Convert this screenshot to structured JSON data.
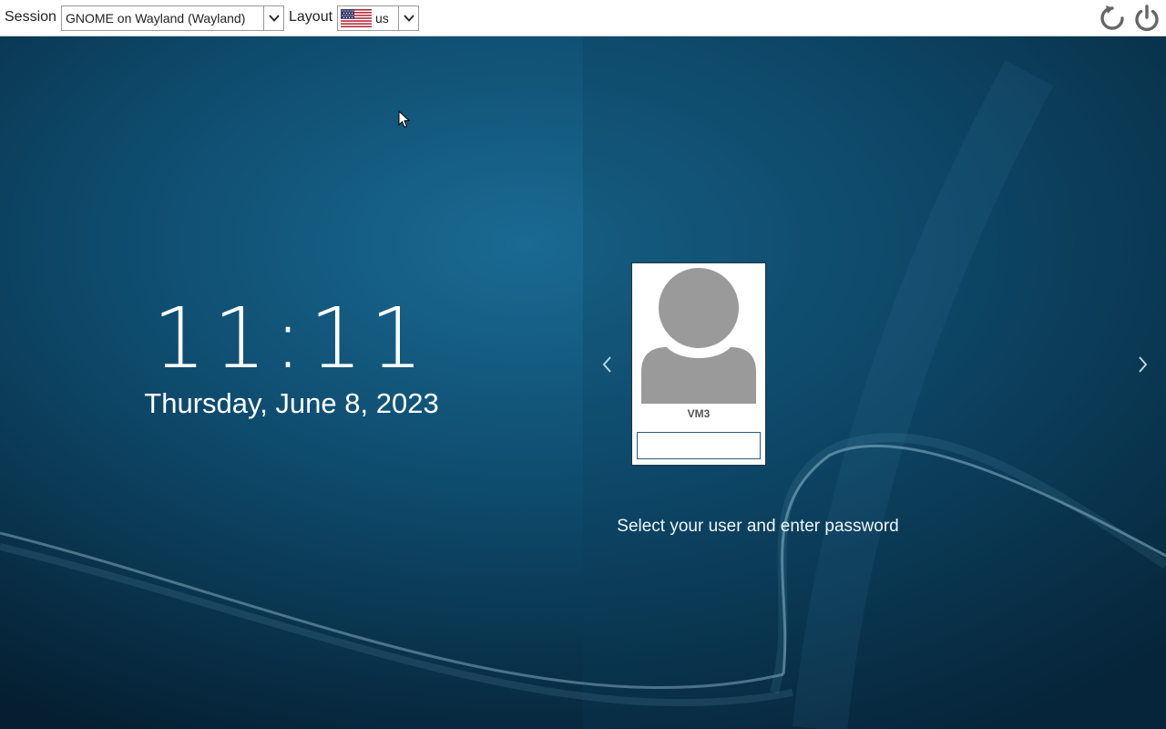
{
  "topbar": {
    "session_label": "Session",
    "session_value": "GNOME on Wayland (Wayland)",
    "layout_label": "Layout",
    "layout_value": "us",
    "layout_flag_icon": "us-flag-icon",
    "restart_icon": "restart-icon",
    "power_icon": "power-icon"
  },
  "greeter": {
    "time": "11:11",
    "date": "Thursday, June 8, 2023",
    "user": {
      "name": "VM3",
      "password_value": ""
    },
    "prev_icon": "chevron-left-icon",
    "next_icon": "chevron-right-icon",
    "hint": "Select your user and enter password"
  },
  "colors": {
    "background": "#0b3a55",
    "text": "#ffffff",
    "avatar": "#9a9a9a"
  }
}
